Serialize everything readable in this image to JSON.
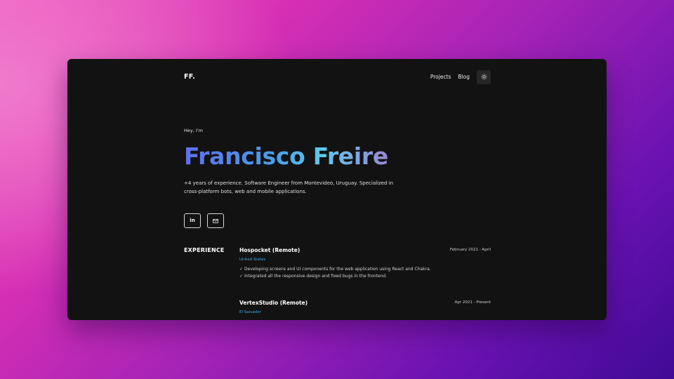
{
  "header": {
    "logo": "FF.",
    "nav": [
      "Projects",
      "Blog"
    ],
    "theme_toggle_icon": "sun-icon"
  },
  "hero": {
    "greeting": "Hey, I'm",
    "name": "Francisco Freire",
    "bio": "+4 years of experience. Software Engineer from Montevideo, Uruguay. Specialized in cross-platform bots, web and mobile applications."
  },
  "social": {
    "linkedin_label": "in",
    "linkedin_icon": "linkedin-icon",
    "email_icon": "mail-icon"
  },
  "experience": {
    "title": "EXPERIENCE",
    "jobs": [
      {
        "title": "Hospocket (Remote)",
        "date": "February 2021 - April",
        "location": "United States",
        "bullets": [
          "Developing screens and UI components for the web application using React and Chakra.",
          "Integrated all the responsive design and fixed bugs in the frontend."
        ]
      },
      {
        "title": "VertexStudio (Remote)",
        "date": "Apr 2021 - Present",
        "location": "El Salvador",
        "bullets": []
      }
    ]
  },
  "colors": {
    "window_bg": "#121212",
    "accent_blue": "#3fa9e8",
    "name_gradient_start": "#5f6ef0",
    "name_gradient_end": "#9b86d2",
    "background_pink": "#ee5cc0",
    "background_purple": "#400a96"
  }
}
